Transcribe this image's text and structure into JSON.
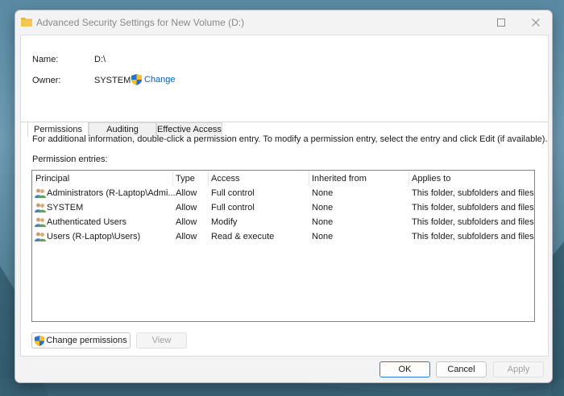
{
  "window": {
    "title": "Advanced Security Settings for New Volume (D:)"
  },
  "info": {
    "name_label": "Name:",
    "name_value": "D:\\",
    "owner_label": "Owner:",
    "owner_value": "SYSTEM",
    "change_link": "Change"
  },
  "tabs": [
    {
      "label": "Permissions",
      "active": true
    },
    {
      "label": "Auditing",
      "active": false
    },
    {
      "label": "Effective Access",
      "active": false
    }
  ],
  "panel": {
    "instructions": "For additional information, double-click a permission entry. To modify a permission entry, select the entry and click Edit (if available).",
    "entries_label": "Permission entries:"
  },
  "table": {
    "headers": [
      "Principal",
      "Type",
      "Access",
      "Inherited from",
      "Applies to"
    ],
    "rows": [
      {
        "principal": "Administrators (R-Laptop\\Admi...",
        "type": "Allow",
        "access": "Full control",
        "inherited": "None",
        "applies": "This folder, subfolders and files"
      },
      {
        "principal": "SYSTEM",
        "type": "Allow",
        "access": "Full control",
        "inherited": "None",
        "applies": "This folder, subfolders and files"
      },
      {
        "principal": "Authenticated Users",
        "type": "Allow",
        "access": "Modify",
        "inherited": "None",
        "applies": "This folder, subfolders and files"
      },
      {
        "principal": "Users (R-Laptop\\Users)",
        "type": "Allow",
        "access": "Read & execute",
        "inherited": "None",
        "applies": "This folder, subfolders and files"
      }
    ]
  },
  "buttons": {
    "change_permissions": "Change permissions",
    "view": "View",
    "ok": "OK",
    "cancel": "Cancel",
    "apply": "Apply"
  },
  "colors": {
    "link": "#0c5fb5",
    "accent": "#2d7dcc"
  }
}
